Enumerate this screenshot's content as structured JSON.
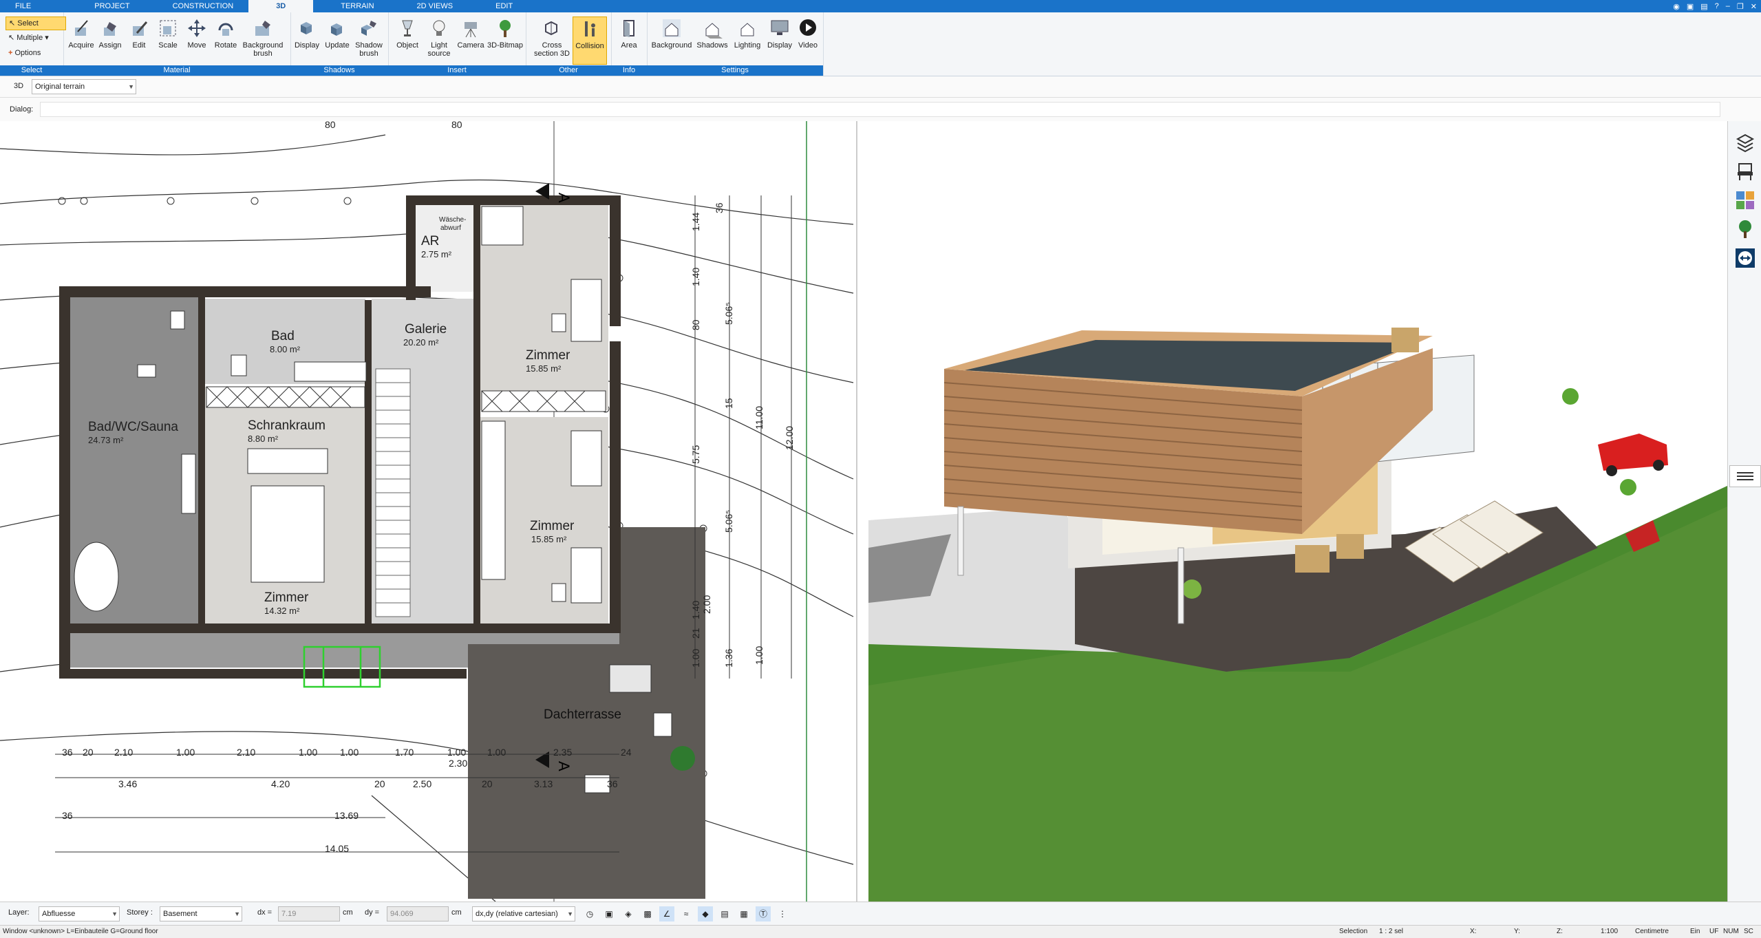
{
  "menu": {
    "tabs": [
      "FILE",
      "PROJECT",
      "CONSTRUCTION",
      "3D",
      "TERRAIN",
      "2D VIEWS",
      "EDIT"
    ],
    "active": "3D"
  },
  "ribbon": {
    "select_group": {
      "select": "Select",
      "multiple": "Multiple",
      "options": "Options",
      "label": "Select"
    },
    "material": {
      "label": "Material",
      "buttons": [
        "Acquire",
        "Assign",
        "Edit",
        "Scale",
        "Move",
        "Rotate",
        "Background brush"
      ]
    },
    "shadows": {
      "label": "Shadows",
      "buttons": [
        "Display",
        "Update",
        "Shadow brush"
      ]
    },
    "insert": {
      "label": "Insert",
      "buttons": [
        "Object",
        "Light source",
        "Camera",
        "3D-Bitmap"
      ]
    },
    "other": {
      "label": "Other",
      "buttons": [
        "Cross section 3D",
        "Collision"
      ]
    },
    "info": {
      "label": "Info",
      "buttons": [
        "Area"
      ]
    },
    "settings": {
      "label": "Settings",
      "buttons": [
        "Background",
        "Shadows",
        "Lighting",
        "Display",
        "Video"
      ]
    }
  },
  "toolbar": {
    "mode": "3D",
    "terrain_select": "Original terrain",
    "dialog_label": "Dialog:"
  },
  "plan": {
    "rooms": [
      {
        "name": "AR",
        "area": "2.75 m²"
      },
      {
        "name": "Wäsche-",
        "area": "abwurf"
      },
      {
        "name": "Bad",
        "area": "8.00 m²"
      },
      {
        "name": "Galerie",
        "area": "20.20 m²"
      },
      {
        "name": "Zimmer",
        "area": "15.85 m²"
      },
      {
        "name": "Bad/WC/Sauna",
        "area": "24.73 m²"
      },
      {
        "name": "Schrankraum",
        "area": "8.80 m²"
      },
      {
        "name": "Zimmer",
        "area": "15.85 m²"
      },
      {
        "name": "Zimmer",
        "area": "14.32 m²"
      },
      {
        "name": "Dachterrasse",
        "area": ""
      }
    ],
    "top_dims": [
      "80",
      "80"
    ],
    "dims_bottom_row1": [
      "36",
      "20",
      "2.10",
      "1.00",
      "2.10",
      "1.00",
      "1.00",
      "1.70",
      "1.00",
      "1.00",
      "2.35",
      "24"
    ],
    "dims_bottom_row2": [
      "3.46",
      "4.20",
      "20",
      "2.50",
      "20",
      "3.13",
      "36"
    ],
    "dims_bottom_misc": [
      "2.30"
    ],
    "dims_bottom_row3": [
      "36",
      "13.69"
    ],
    "dims_bottom_row4": "14.05",
    "dims_right_a": [
      "36",
      "1.44",
      "1.40",
      "80",
      "15",
      "5.75",
      "1.40",
      "21",
      "1.00",
      "1.36"
    ],
    "dims_right_b": [
      "5.06⁵",
      "5.06⁵",
      "2.00"
    ],
    "dims_right_c": [
      "11.00",
      "1.00"
    ],
    "dims_right_d": "12.00",
    "section_mark": "A"
  },
  "status": {
    "layer_label": "Layer:",
    "layer_value": "Abfluesse",
    "storey_label": "Storey :",
    "storey_value": "Basement",
    "dx_label": "dx =",
    "dx_value": "7.19",
    "dy_label": "dy =",
    "dy_value": "94.069",
    "unit": "cm",
    "coord_mode": "dx,dy (relative cartesian)"
  },
  "bottom": {
    "window_info": "Window <unknown> L=Einbauteile G=Ground floor",
    "selection_label": "Selection",
    "selection_value": "1 : 2 sel",
    "x": "X:",
    "y": "Y:",
    "z": "Z:",
    "scale": "1:100",
    "unit": "Centimetre",
    "ein": "Ein",
    "uf": "UF",
    "num": "NUM",
    "sc": "SC"
  },
  "colors": {
    "accent": "#1a73c9",
    "active_button": "#ffd970",
    "wall": "#3a332d",
    "floor_gray": "#d8d6d2",
    "grass": "#4a8a2e"
  }
}
